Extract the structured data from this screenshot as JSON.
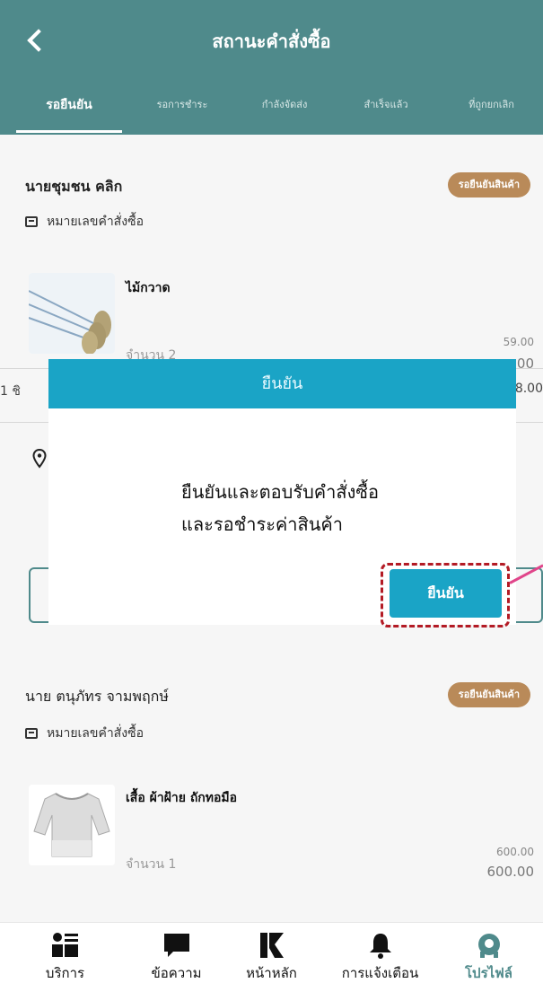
{
  "header": {
    "title": "สถานะคำสั่งซื้อ"
  },
  "tabs": [
    {
      "label": "รอยืนยัน"
    },
    {
      "label": "รอการชำระ"
    },
    {
      "label": "กำลังจัดส่ง"
    },
    {
      "label": "สำเร็จแล้ว"
    },
    {
      "label": "ที่ถูกยกเลิก"
    }
  ],
  "orders": [
    {
      "buyer": "นายชุมชน คลิก",
      "status": "รอยืนยันสินค้า",
      "order_no_label": "หมายเลขคำสั่งซื้อ",
      "product_name": "ไม้กวาด",
      "qty": "จำนวน 2",
      "unit_price": "59.00",
      "total_price": ".00"
    },
    {
      "buyer": "นาย ตนุภัทร จามพฤกษ์",
      "status": "รอยืนยันสินค้า",
      "order_no_label": "หมายเลขคำสั่งซื้อ",
      "product_name": "เสื้อ ผ้าฝ้าย ถักทอมือ",
      "qty": "จำนวน 1",
      "unit_price": "600.00",
      "total_price": "600.00"
    }
  ],
  "summary": {
    "left_fragment": "1 ชิ",
    "right_fragment": "8.00"
  },
  "modal": {
    "title": "ยืนยัน",
    "line1": "ยืนยันและตอบรับคำสั่งซื้อ",
    "line2": "และรอชำระค่าสินค้า",
    "confirm_label": "ยืนยัน"
  },
  "bottom_nav": [
    {
      "label": "บริการ",
      "icon": "services-icon"
    },
    {
      "label": "ข้อความ",
      "icon": "message-icon"
    },
    {
      "label": "หน้าหลัก",
      "icon": "home-logo-icon"
    },
    {
      "label": "การแจ้งเตือน",
      "icon": "bell-icon"
    },
    {
      "label": "โปรไฟล์",
      "icon": "profile-icon"
    }
  ],
  "colors": {
    "header": "#4f8a8b",
    "modal_accent": "#1aa4c6",
    "badge": "#b98a59",
    "highlight": "#b31b25"
  }
}
